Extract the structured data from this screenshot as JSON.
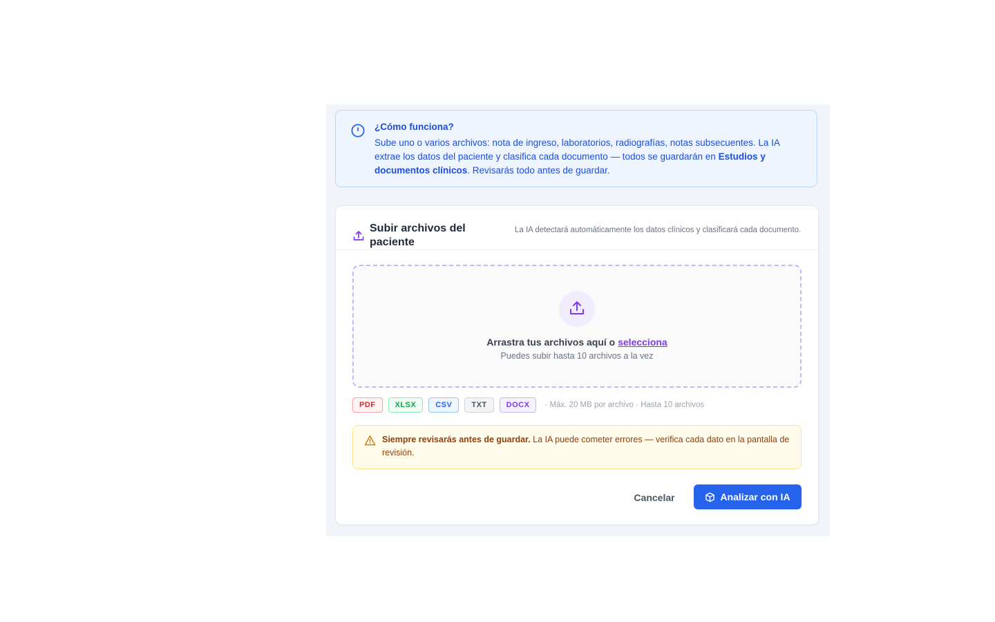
{
  "info": {
    "title": "¿Cómo funciona?",
    "body_intro": "Sube uno o varios archivos: nota de ingreso, laboratorios, radiografías, notas subsecuentes. La IA extrae los datos del paciente y clasifica cada documento — todos se guardarán en ",
    "body_bold": "Estudios y documentos clínicos",
    "body_end": ". Revisarás todo antes de guardar.",
    "icon": "info-circle-icon"
  },
  "upload": {
    "title": "Subir archivos del paciente",
    "subtitle": "La IA detectará automáticamente los datos clínicos y clasificará cada documento.",
    "icon": "upload-icon",
    "dropzone": {
      "text": "Arrastra tus archivos aquí o ",
      "link": "selecciona",
      "hint": "Puedes subir hasta 10 archivos a la vez",
      "icon": "upload-tray-icon"
    },
    "formats": [
      "PDF",
      "XLSX",
      "CSV",
      "TXT",
      "DOCX"
    ],
    "format_note": "· Máx. 20 MB por archivo · Hasta 10 archivos"
  },
  "warning": {
    "bold": "Siempre revisarás antes de guardar.",
    "text": " La IA puede cometer errores — verifica cada dato en la pantalla de revisión.",
    "icon": "warning-triangle-icon"
  },
  "actions": {
    "cancel": "Cancelar",
    "analyze": "Analizar con IA",
    "analyze_icon": "cube-icon"
  },
  "colors": {
    "primary": "#2563eb",
    "accent_purple": "#7c3aed",
    "info_text": "#1d4ed8",
    "warning_text": "#92400e"
  }
}
